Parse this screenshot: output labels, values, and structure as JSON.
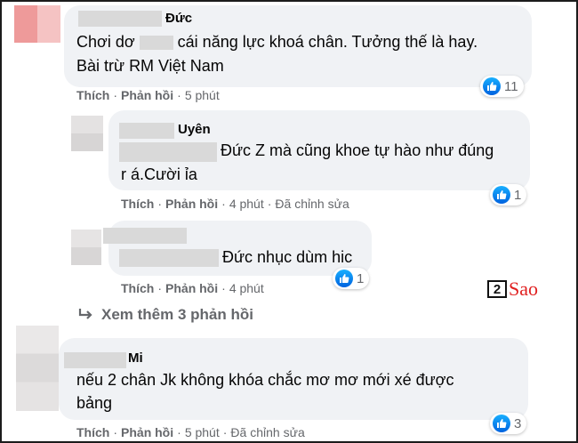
{
  "comments": [
    {
      "name": "Đức",
      "text_line1": "Chơi dơ",
      "text_line1b": "cái năng lực khoá chân. Tưởng thế là hay.",
      "text_line2": "Bài trừ RM Việt Nam",
      "like_label": "Thích",
      "reply_label": "Phản hồi",
      "time": "5 phút",
      "reactions": "11"
    },
    {
      "name": "Uyên",
      "text_line1": "Đức Z mà cũng khoe tự hào như đúng",
      "text_line2": "r á.Cười ỉa",
      "like_label": "Thích",
      "reply_label": "Phản hồi",
      "time": "4 phút",
      "edited": "Đã chỉnh sửa",
      "reactions": "1"
    },
    {
      "text_line1": "Đức nhục dùm hic",
      "like_label": "Thích",
      "reply_label": "Phản hồi",
      "time": "4 phút",
      "reactions": "1"
    },
    {
      "name": "Mi",
      "text_line1": "nếu 2 chân Jk không khóa chắc mơ mơ mới xé được",
      "text_line2": "bảng",
      "like_label": "Thích",
      "reply_label": "Phản hồi",
      "time": "5 phút",
      "edited": "Đã chỉnh sửa",
      "reactions": "3"
    }
  ],
  "view_more": "Xem thêm 3 phản hồi",
  "watermark": {
    "num": "2",
    "word": "Sao"
  },
  "colors": {
    "bubble": "#f0f2f5",
    "meta": "#65676b",
    "like": "#1877f2",
    "watermark": "#e02020"
  }
}
